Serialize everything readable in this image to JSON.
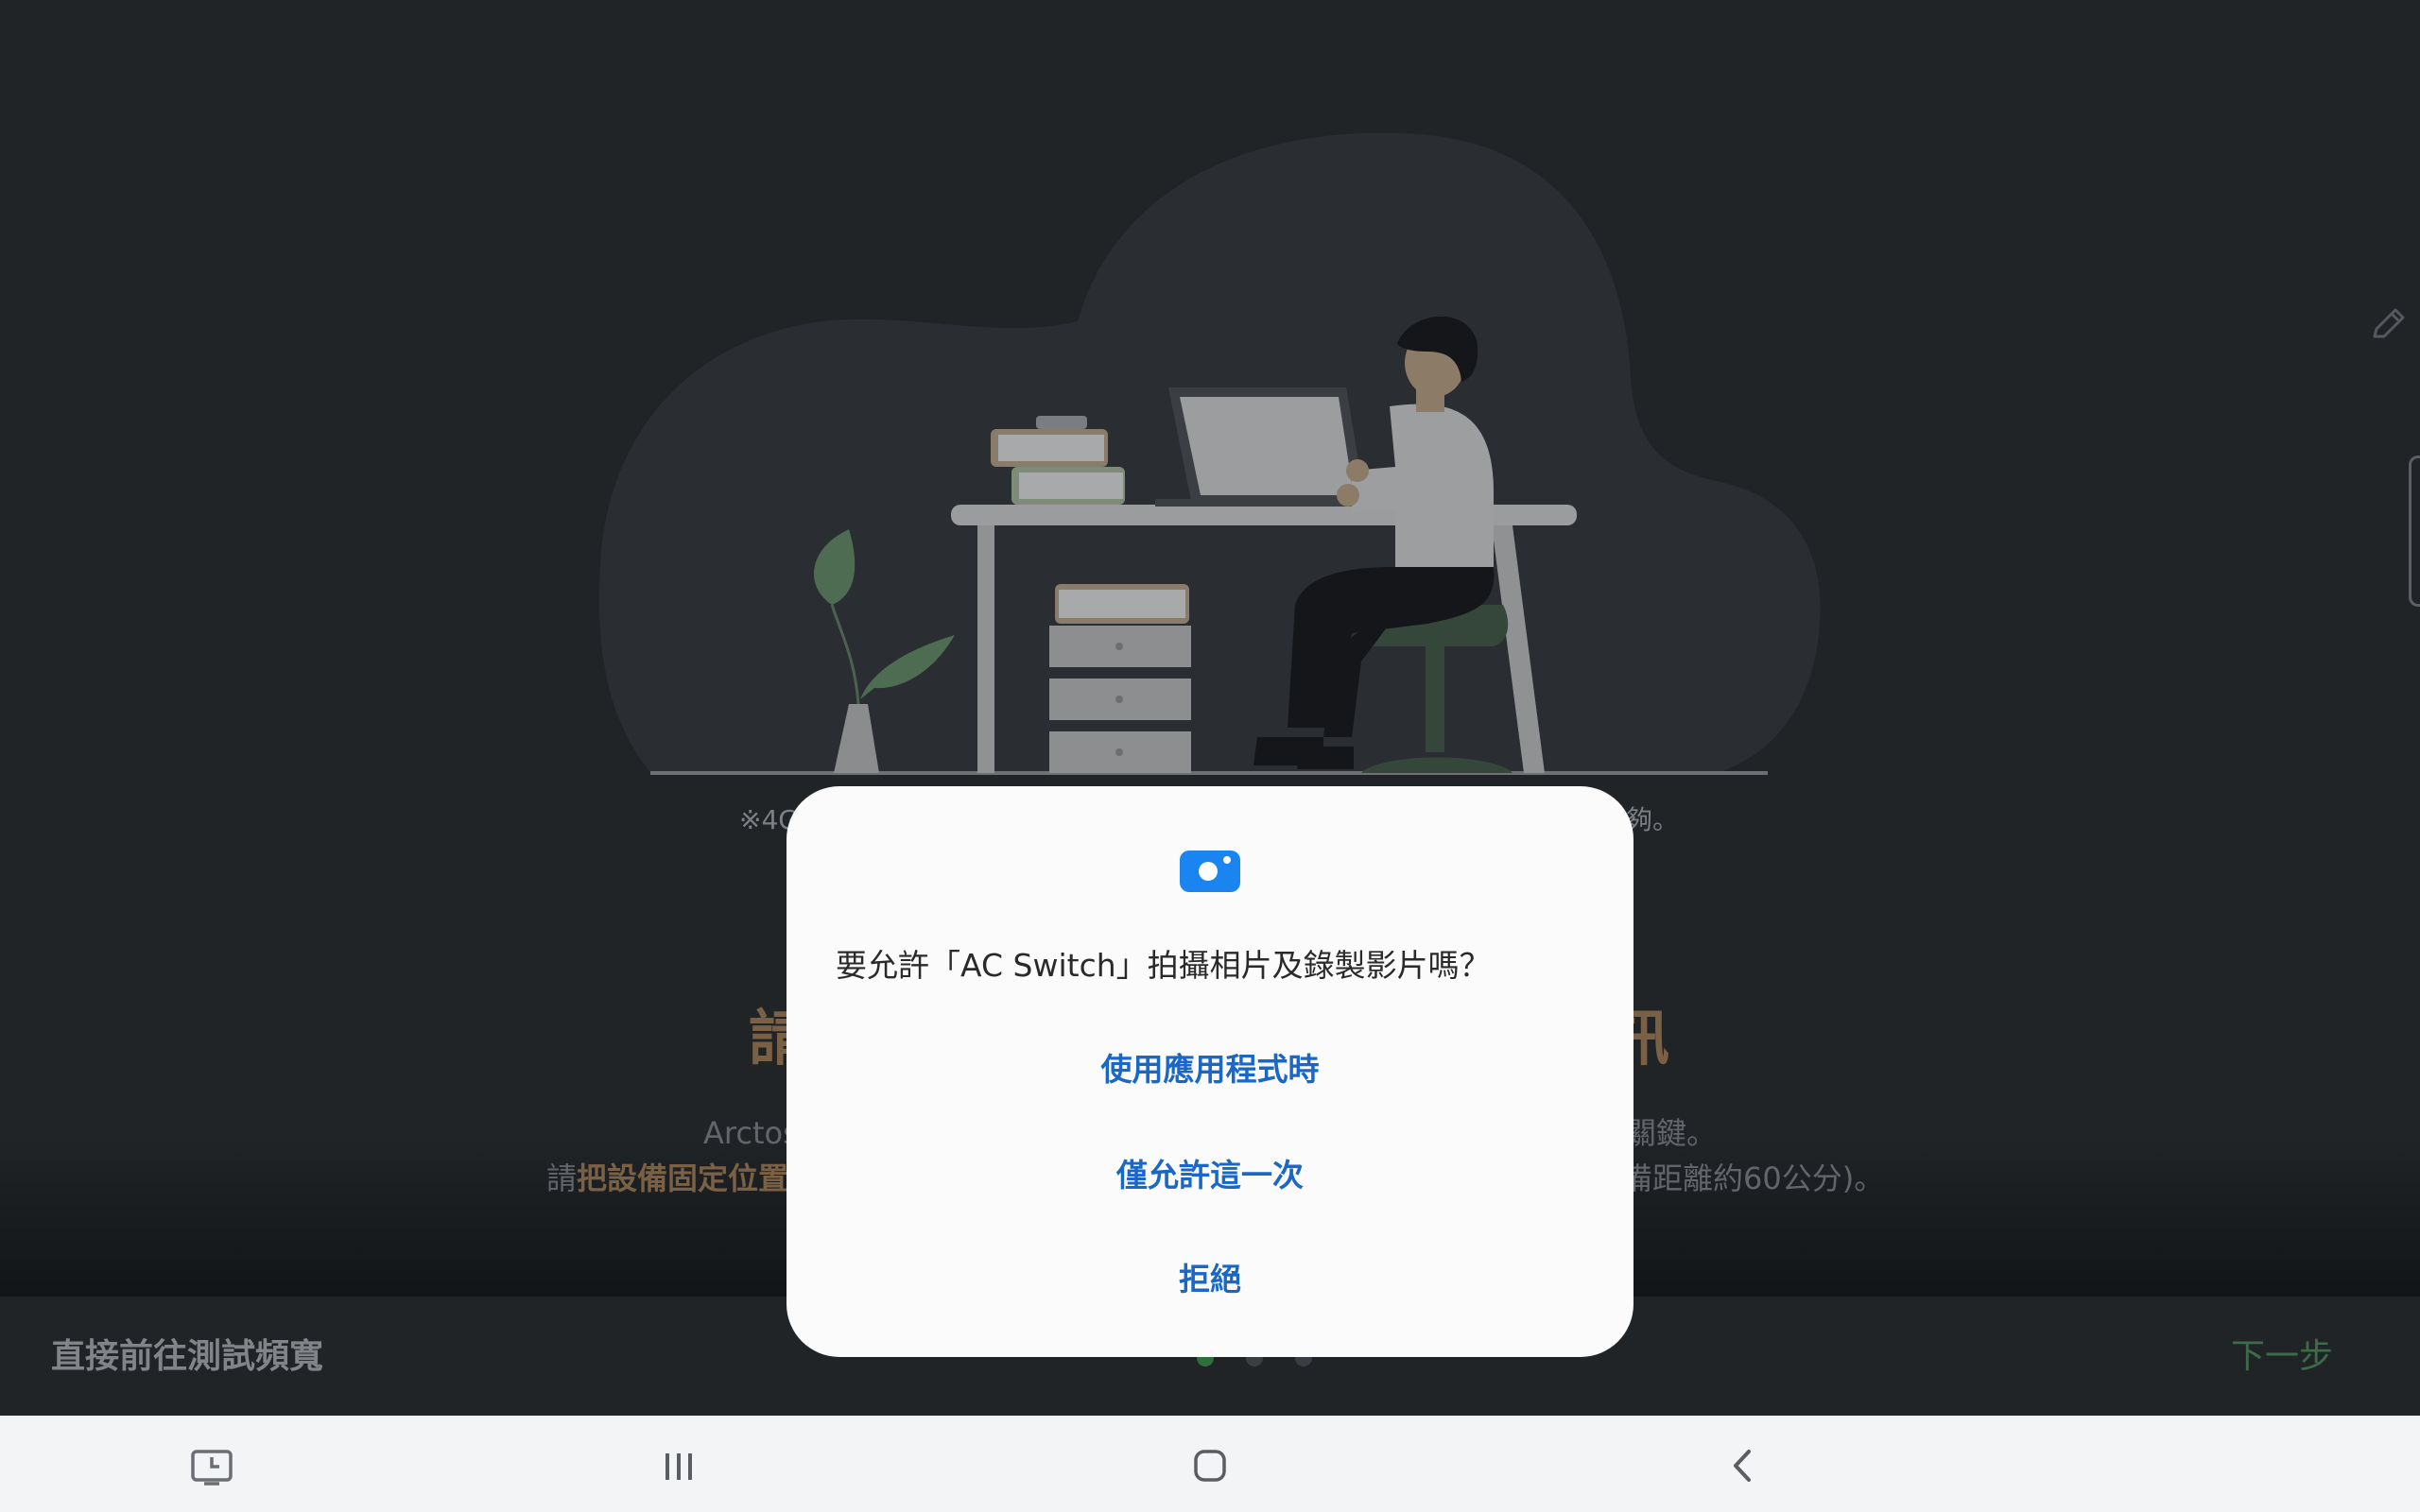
{
  "onboarding": {
    "note_left": "※4G",
    "note_right": "夠。",
    "heading_left": "請",
    "heading_right": "訊",
    "desc_line1_left": "Arctos",
    "desc_line1_right": "關鍵。",
    "desc_line2_prefix": "請",
    "desc_line2_bold": "把設備固定位置",
    "desc_line2_right": "備距離約60公分)。"
  },
  "bottom_bar": {
    "skip_label": "直接前往測試頻寬",
    "next_label": "下一步",
    "page_count": 3,
    "current_page": 1
  },
  "permission_dialog": {
    "icon": "camera-icon",
    "message": "要允許「AC Switch」拍攝相片及錄製影片嗎？",
    "allow_while_using_label": "使用應用程式時",
    "allow_once_label": "僅允許這一次",
    "deny_label": "拒絕"
  },
  "system_nav": {
    "buttons": [
      "screen-recorder-icon",
      "recent-apps-icon",
      "home-icon",
      "back-icon"
    ]
  },
  "colors": {
    "dialog_accent": "#1a67c6",
    "brand_highlight": "#7a6145",
    "next_button": "#3c6b47",
    "camera_icon": "#1a84f0"
  }
}
